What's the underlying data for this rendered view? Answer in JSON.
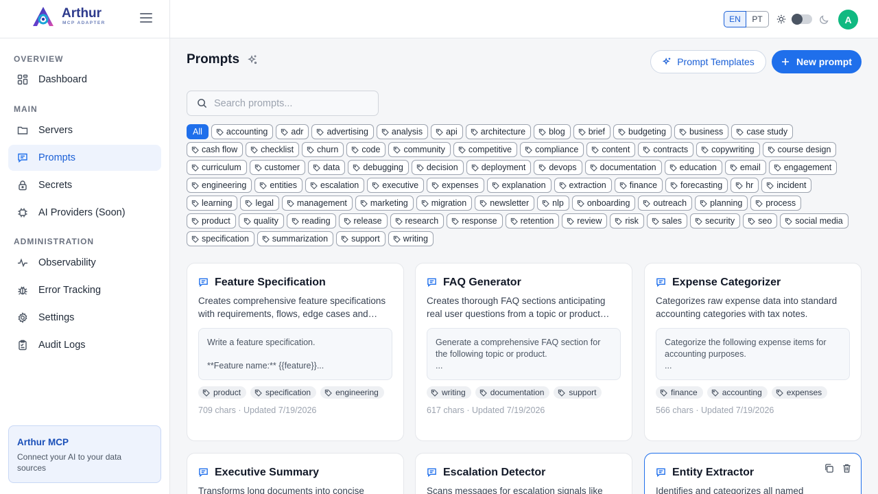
{
  "brand": {
    "name": "Arthur",
    "subtitle": "MCP ADAPTER"
  },
  "sidebar": {
    "sections": {
      "overview": "OVERVIEW",
      "main": "MAIN",
      "administration": "ADMINISTRATION"
    },
    "items": [
      {
        "label": "Dashboard",
        "icon": "dashboard-icon"
      },
      {
        "label": "Servers",
        "icon": "folder-icon"
      },
      {
        "label": "Prompts",
        "icon": "message-icon",
        "active": true
      },
      {
        "label": "Secrets",
        "icon": "lock-icon"
      },
      {
        "label": "AI Providers (Soon)",
        "icon": "chip-icon"
      },
      {
        "label": "Observability",
        "icon": "pulse-icon"
      },
      {
        "label": "Error Tracking",
        "icon": "bug-icon"
      },
      {
        "label": "Settings",
        "icon": "gear-icon"
      },
      {
        "label": "Audit Logs",
        "icon": "clipboard-icon"
      }
    ],
    "promo": {
      "title": "Arthur MCP",
      "text": "Connect your AI to your data sources"
    }
  },
  "header": {
    "languages": [
      "EN",
      "PT"
    ],
    "active_language": "EN",
    "avatar_initial": "A"
  },
  "main": {
    "title": "Prompts",
    "templates_button": "Prompt Templates",
    "new_button": "New prompt",
    "search": {
      "placeholder": "Search prompts...",
      "value": ""
    },
    "tags": [
      "All",
      "accounting",
      "adr",
      "advertising",
      "analysis",
      "api",
      "architecture",
      "blog",
      "brief",
      "budgeting",
      "business",
      "case study",
      "cash flow",
      "checklist",
      "churn",
      "code",
      "community",
      "competitive",
      "compliance",
      "content",
      "contracts",
      "copywriting",
      "course design",
      "curriculum",
      "customer",
      "data",
      "debugging",
      "decision",
      "deployment",
      "devops",
      "documentation",
      "education",
      "email",
      "engagement",
      "engineering",
      "entities",
      "escalation",
      "executive",
      "expenses",
      "explanation",
      "extraction",
      "finance",
      "forecasting",
      "hr",
      "incident",
      "learning",
      "legal",
      "management",
      "marketing",
      "migration",
      "newsletter",
      "nlp",
      "onboarding",
      "outreach",
      "planning",
      "process",
      "product",
      "quality",
      "reading",
      "release",
      "research",
      "response",
      "retention",
      "review",
      "risk",
      "sales",
      "security",
      "seo",
      "social media",
      "specification",
      "summarization",
      "support",
      "writing"
    ],
    "active_tag": "All",
    "cards": [
      {
        "title": "Feature Specification",
        "description": "Creates comprehensive feature specifications with requirements, flows, edge cases and acceptance criteria.",
        "preview": "Write a feature specification.\n\n**Feature name:** {{feature}}...",
        "tags": [
          "product",
          "specification",
          "engineering"
        ],
        "meta": "709 chars · Updated 7/19/2026"
      },
      {
        "title": "FAQ Generator",
        "description": "Creates thorough FAQ sections anticipating real user questions from a topic or product description.",
        "preview": "Generate a comprehensive FAQ section for the following topic or product.\n...",
        "tags": [
          "writing",
          "documentation",
          "support"
        ],
        "meta": "617 chars · Updated 7/19/2026"
      },
      {
        "title": "Expense Categorizer",
        "description": "Categorizes raw expense data into standard accounting categories with tax notes.",
        "preview": "Categorize the following expense items for accounting purposes.\n...",
        "tags": [
          "finance",
          "accounting",
          "expenses"
        ],
        "meta": "566 chars · Updated 7/19/2026"
      },
      {
        "title": "Executive Summary",
        "description": "Transforms long documents into concise summaries",
        "preview": "",
        "tags": [],
        "meta": ""
      },
      {
        "title": "Escalation Detector",
        "description": "Scans messages for escalation signals like",
        "preview": "",
        "tags": [],
        "meta": ""
      },
      {
        "title": "Entity Extractor",
        "description": "Identifies and categorizes all named",
        "preview": "",
        "tags": [],
        "meta": ""
      }
    ]
  },
  "colors": {
    "accent": "#1f6feb",
    "avatar": "#10b981",
    "brand": "#2d3a8c"
  }
}
